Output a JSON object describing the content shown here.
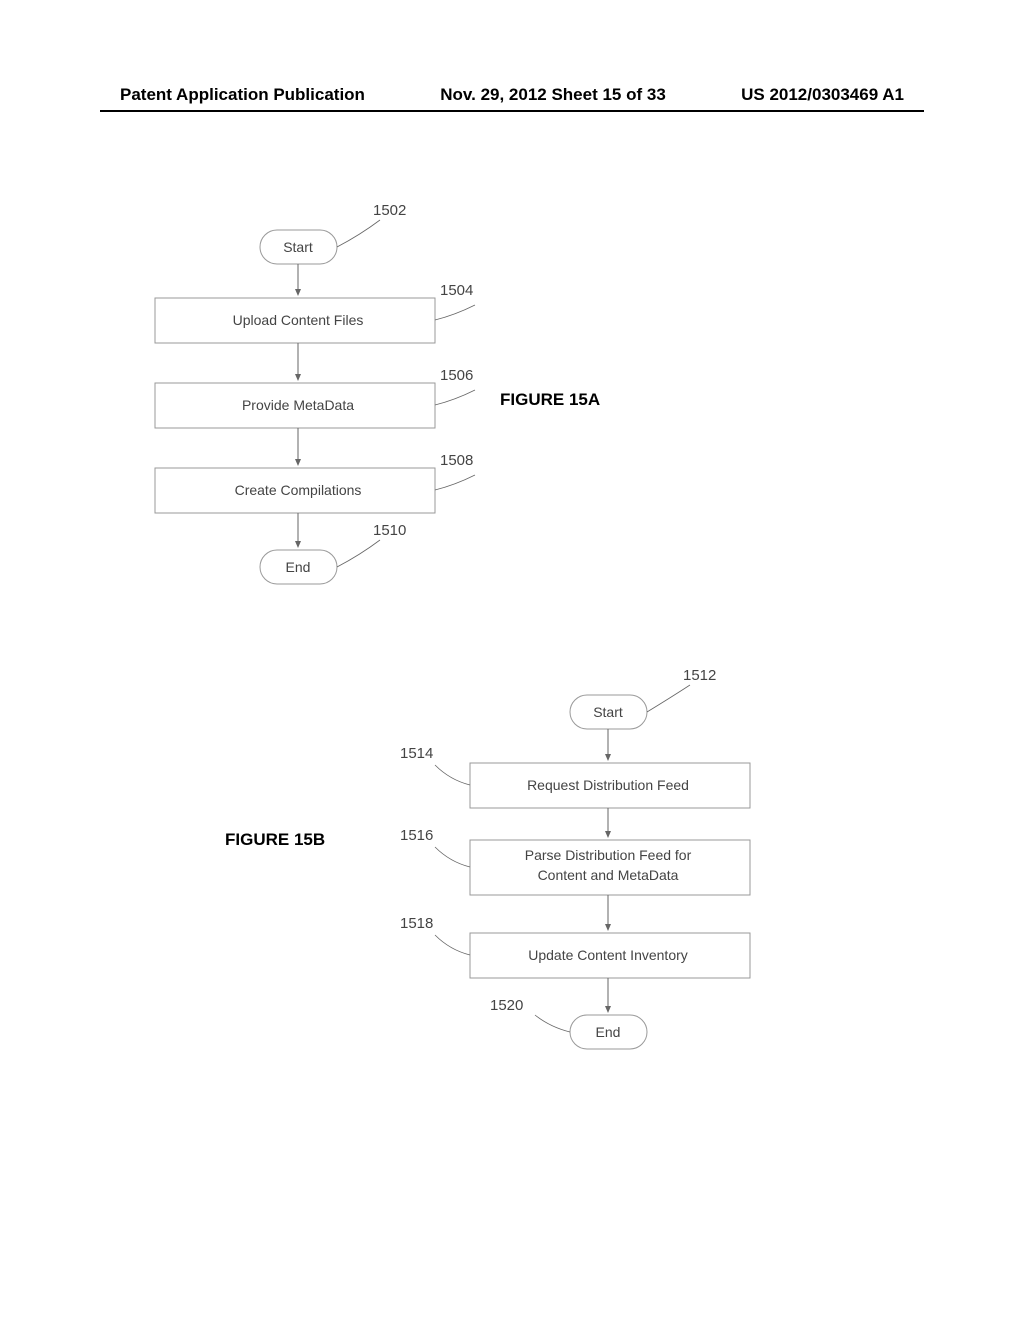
{
  "header": {
    "left": "Patent Application Publication",
    "center": "Nov. 29, 2012  Sheet 15 of 33",
    "right": "US 2012/0303469 A1"
  },
  "figureA": {
    "label": "FIGURE 15A",
    "nodes": {
      "start": {
        "text": "Start",
        "ref": "1502"
      },
      "upload": {
        "text": "Upload Content Files",
        "ref": "1504"
      },
      "metadata": {
        "text": "Provide MetaData",
        "ref": "1506"
      },
      "compilations": {
        "text": "Create Compilations",
        "ref": "1508"
      },
      "end": {
        "text": "End",
        "ref": "1510"
      }
    }
  },
  "figureB": {
    "label": "FIGURE 15B",
    "nodes": {
      "start": {
        "text": "Start",
        "ref": "1512"
      },
      "request": {
        "text": "Request Distribution Feed",
        "ref": "1514"
      },
      "parse": {
        "text1": "Parse Distribution Feed for",
        "text2": "Content and MetaData",
        "ref": "1516"
      },
      "update": {
        "text": "Update Content Inventory",
        "ref": "1518"
      },
      "end": {
        "text": "End",
        "ref": "1520"
      }
    }
  }
}
